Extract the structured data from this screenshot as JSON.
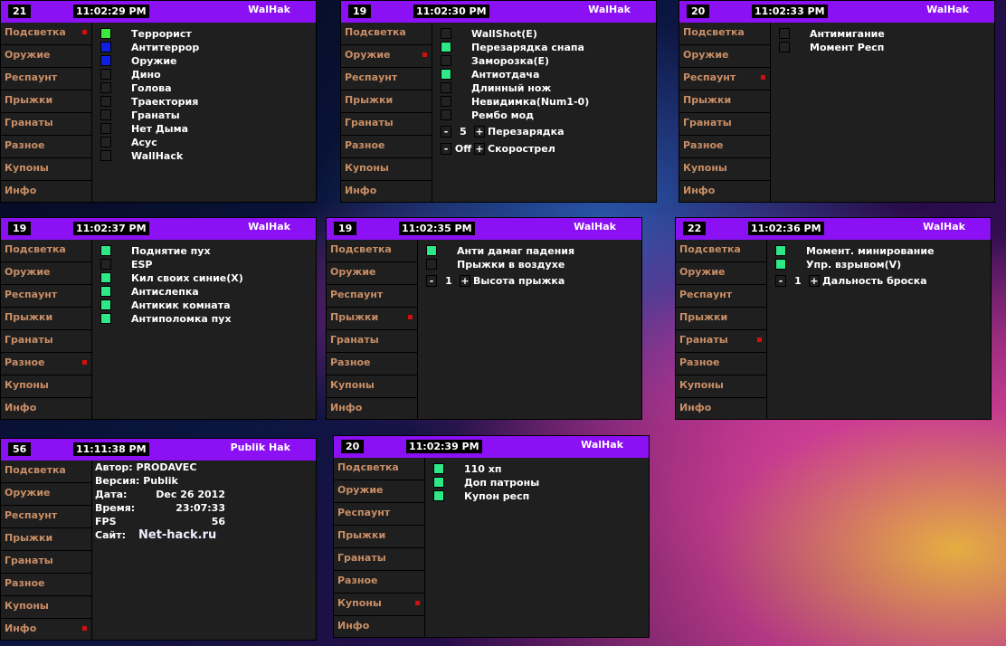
{
  "colors": {
    "header": "#8c10f4",
    "on_green": "#3de63d",
    "on_blue": "#1020e0",
    "on_mint": "#2ee888",
    "menu_text": "#c98e66",
    "active_marker": "#d01010"
  },
  "menu": [
    "Подсветка",
    "Оружие",
    "Респаунт",
    "Прыжки",
    "Гранаты",
    "Разное",
    "Купоны",
    "Инфо"
  ],
  "panels": [
    {
      "num": "21",
      "time": "11:02:29 PM",
      "title": "WalHak",
      "active": 0,
      "items": [
        {
          "label": "Террорист",
          "state": "green"
        },
        {
          "label": "Антитеррор",
          "state": "blue"
        },
        {
          "label": "Оружие",
          "state": "blue"
        },
        {
          "label": "Дино",
          "state": "off"
        },
        {
          "label": "Голова",
          "state": "off"
        },
        {
          "label": "Траектория",
          "state": "off"
        },
        {
          "label": "Гранаты",
          "state": "off"
        },
        {
          "label": "Нет Дыма",
          "state": "off"
        },
        {
          "label": "Асус",
          "state": "off"
        },
        {
          "label": "WallHack",
          "state": "off"
        }
      ],
      "steppers": []
    },
    {
      "num": "19",
      "time": "11:02:30 PM",
      "title": "WalHak",
      "active": 1,
      "items": [
        {
          "label": "WallShot(E)",
          "state": "off"
        },
        {
          "label": "Перезарядка снапа",
          "state": "mint"
        },
        {
          "label": "Заморозка(E)",
          "state": "off"
        },
        {
          "label": "Антиотдача",
          "state": "mint"
        },
        {
          "label": "Длинный нож",
          "state": "off"
        },
        {
          "label": "Невидимка(Num1-0)",
          "state": "off"
        },
        {
          "label": "Рембо мод",
          "state": "off"
        }
      ],
      "steppers": [
        {
          "minus": "-",
          "value": "5",
          "plus": "+",
          "label": "Перезарядка"
        },
        {
          "minus": "-",
          "value": "Off",
          "plus": "+",
          "label": "Скорострел"
        }
      ]
    },
    {
      "num": "20",
      "time": "11:02:33 PM",
      "title": "WalHak",
      "active": 2,
      "items": [
        {
          "label": "Антимигание",
          "state": "off"
        },
        {
          "label": "Момент Респ",
          "state": "off"
        }
      ],
      "steppers": []
    },
    {
      "num": "19",
      "time": "11:02:37 PM",
      "title": "WalHak",
      "active": 5,
      "items": [
        {
          "label": "Поднятие пух",
          "state": "mint"
        },
        {
          "label": "ESP",
          "state": "off"
        },
        {
          "label": "Кил своих синие(X)",
          "state": "mint"
        },
        {
          "label": "Антислепка",
          "state": "mint"
        },
        {
          "label": "Антикик комната",
          "state": "mint"
        },
        {
          "label": "Антиполомка пух",
          "state": "mint"
        }
      ],
      "steppers": []
    },
    {
      "num": "19",
      "time": "11:02:35 PM",
      "title": "WalHak",
      "active": 3,
      "items": [
        {
          "label": "Анти дамаг падения",
          "state": "mint"
        },
        {
          "label": "Прыжки в воздухе",
          "state": "off"
        }
      ],
      "steppers": [
        {
          "minus": "-",
          "value": "1",
          "plus": "+",
          "label": "Высота прыжка"
        }
      ]
    },
    {
      "num": "22",
      "time": "11:02:36 PM",
      "title": "WalHak",
      "active": 4,
      "items": [
        {
          "label": "Момент. минирование",
          "state": "mint"
        },
        {
          "label": "Упр. взрывом(V)",
          "state": "mint"
        }
      ],
      "steppers": [
        {
          "minus": "-",
          "value": "1",
          "plus": "+",
          "label": "Дальность броска"
        }
      ]
    },
    {
      "num": "56",
      "time": "11:11:38 PM",
      "title": "Publik Hak",
      "active": 7,
      "info": [
        {
          "key": "Автор: PRODAVEC",
          "value": ""
        },
        {
          "key": "Версия: Publik",
          "value": ""
        },
        {
          "key": "Дата:",
          "value": "Dec 26 2012"
        },
        {
          "key": "Время:",
          "value": "23:07:33"
        },
        {
          "key": "FPS",
          "value": "56"
        },
        {
          "key": "Сайт:",
          "site": "Net-hack.ru"
        }
      ]
    },
    {
      "num": "20",
      "time": "11:02:39 PM",
      "title": "WalHak",
      "active": 6,
      "items": [
        {
          "label": "110 хп",
          "state": "mint"
        },
        {
          "label": "Доп патроны",
          "state": "mint"
        },
        {
          "label": "Купон респ",
          "state": "mint"
        }
      ],
      "steppers": []
    }
  ]
}
